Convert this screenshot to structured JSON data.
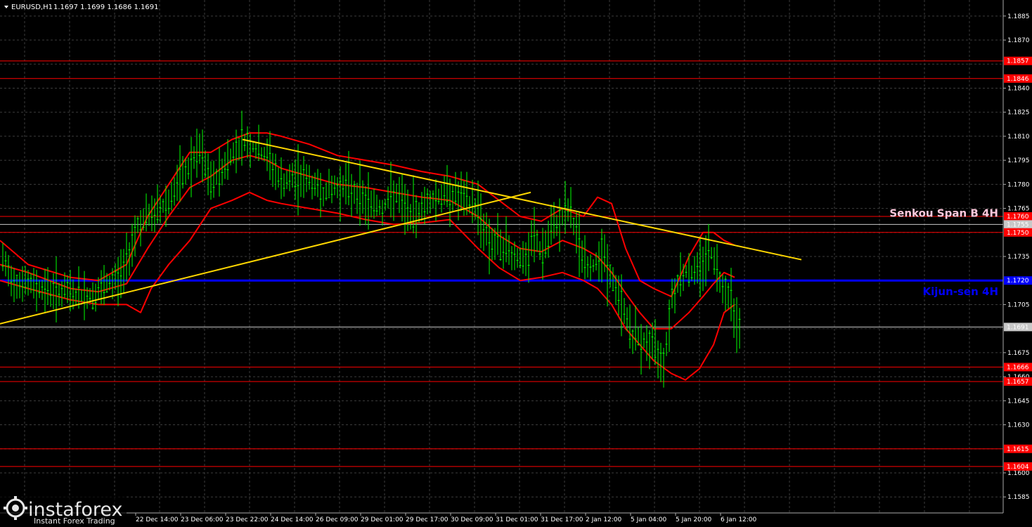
{
  "chart_data": {
    "type": "line",
    "header": {
      "symbol": "EURUSD,H1",
      "ohlc": "1.1697 1.1699 1.1686 1.1691"
    },
    "y_ticks": [
      "1.1885",
      "1.1870",
      "1.1840",
      "1.1825",
      "1.1810",
      "1.1795",
      "1.1780",
      "1.1765",
      "1.1735",
      "1.1705",
      "1.1675",
      "1.1660",
      "1.1645",
      "1.1630",
      "1.1600",
      "1.1585"
    ],
    "x_ticks": [
      "22 Dec 14:00",
      "23 Dec 06:00",
      "23 Dec 22:00",
      "24 Dec 14:00",
      "26 Dec 09:00",
      "29 Dec 01:00",
      "29 Dec 17:00",
      "30 Dec 09:00",
      "31 Dec 01:00",
      "31 Dec 17:00",
      "2 Jan 12:00",
      "5 Jan 04:00",
      "5 Jan 20:00",
      "6 Jan 12:00"
    ],
    "ylim": [
      1.1575,
      1.1895
    ],
    "price_path": [
      [
        0,
        1.174
      ],
      [
        5,
        1.173
      ],
      [
        20,
        1.172
      ],
      [
        60,
        1.1715
      ],
      [
        100,
        1.1712
      ],
      [
        130,
        1.171
      ],
      [
        150,
        1.1715
      ],
      [
        175,
        1.1725
      ],
      [
        195,
        1.1755
      ],
      [
        215,
        1.176
      ],
      [
        240,
        1.177
      ],
      [
        260,
        1.1785
      ],
      [
        285,
        1.18
      ],
      [
        300,
        1.178
      ],
      [
        325,
        1.1795
      ],
      [
        345,
        1.1808
      ],
      [
        370,
        1.18
      ],
      [
        385,
        1.1795
      ],
      [
        400,
        1.178
      ],
      [
        430,
        1.1785
      ],
      [
        460,
        1.1775
      ],
      [
        490,
        1.178
      ],
      [
        520,
        1.177
      ],
      [
        545,
        1.1765
      ],
      [
        560,
        1.1775
      ],
      [
        585,
        1.176
      ],
      [
        610,
        1.177
      ],
      [
        640,
        1.1775
      ],
      [
        660,
        1.177
      ],
      [
        680,
        1.1765
      ],
      [
        695,
        1.1745
      ],
      [
        720,
        1.174
      ],
      [
        750,
        1.173
      ],
      [
        760,
        1.175
      ],
      [
        770,
        1.1735
      ],
      [
        790,
        1.1755
      ],
      [
        810,
        1.1765
      ],
      [
        825,
        1.174
      ],
      [
        840,
        1.1725
      ],
      [
        855,
        1.174
      ],
      [
        870,
        1.172
      ],
      [
        885,
        1.1705
      ],
      [
        900,
        1.1685
      ],
      [
        925,
        1.168
      ],
      [
        945,
        1.167
      ],
      [
        955,
        1.171
      ],
      [
        970,
        1.1725
      ],
      [
        990,
        1.1725
      ],
      [
        1010,
        1.174
      ],
      [
        1025,
        1.172
      ],
      [
        1040,
        1.171
      ],
      [
        1050,
        1.1691
      ]
    ],
    "bands": {
      "upper": [
        [
          0,
          1.1745
        ],
        [
          40,
          1.173
        ],
        [
          100,
          1.1722
        ],
        [
          140,
          1.172
        ],
        [
          180,
          1.173
        ],
        [
          210,
          1.176
        ],
        [
          240,
          1.178
        ],
        [
          270,
          1.18
        ],
        [
          300,
          1.18
        ],
        [
          330,
          1.1808
        ],
        [
          355,
          1.1812
        ],
        [
          380,
          1.1812
        ],
        [
          400,
          1.181
        ],
        [
          440,
          1.1805
        ],
        [
          480,
          1.1798
        ],
        [
          520,
          1.1795
        ],
        [
          560,
          1.1792
        ],
        [
          600,
          1.1788
        ],
        [
          640,
          1.1785
        ],
        [
          680,
          1.178
        ],
        [
          710,
          1.177
        ],
        [
          740,
          1.176
        ],
        [
          770,
          1.1757
        ],
        [
          800,
          1.1765
        ],
        [
          830,
          1.176
        ],
        [
          850,
          1.1772
        ],
        [
          870,
          1.1768
        ],
        [
          890,
          1.174
        ],
        [
          910,
          1.172
        ],
        [
          930,
          1.1715
        ],
        [
          955,
          1.171
        ],
        [
          980,
          1.1735
        ],
        [
          1000,
          1.175
        ],
        [
          1015,
          1.175
        ],
        [
          1030,
          1.1745
        ],
        [
          1045,
          1.1742
        ]
      ],
      "middle": [
        [
          0,
          1.173
        ],
        [
          40,
          1.1725
        ],
        [
          100,
          1.1715
        ],
        [
          140,
          1.1713
        ],
        [
          180,
          1.1718
        ],
        [
          210,
          1.174
        ],
        [
          240,
          1.176
        ],
        [
          270,
          1.1778
        ],
        [
          300,
          1.1785
        ],
        [
          330,
          1.1795
        ],
        [
          355,
          1.1798
        ],
        [
          380,
          1.1795
        ],
        [
          400,
          1.179
        ],
        [
          440,
          1.1785
        ],
        [
          480,
          1.178
        ],
        [
          520,
          1.1778
        ],
        [
          560,
          1.1775
        ],
        [
          600,
          1.1772
        ],
        [
          640,
          1.177
        ],
        [
          680,
          1.176
        ],
        [
          710,
          1.1748
        ],
        [
          740,
          1.174
        ],
        [
          770,
          1.1738
        ],
        [
          800,
          1.1745
        ],
        [
          830,
          1.174
        ],
        [
          850,
          1.1735
        ],
        [
          870,
          1.1725
        ],
        [
          890,
          1.1712
        ],
        [
          910,
          1.17
        ],
        [
          930,
          1.169
        ],
        [
          955,
          1.169
        ],
        [
          980,
          1.17
        ],
        [
          1000,
          1.171
        ],
        [
          1015,
          1.1718
        ],
        [
          1030,
          1.1725
        ],
        [
          1045,
          1.1722
        ]
      ],
      "lower": [
        [
          0,
          1.172
        ],
        [
          40,
          1.1715
        ],
        [
          100,
          1.1708
        ],
        [
          140,
          1.1705
        ],
        [
          180,
          1.1705
        ],
        [
          200,
          1.17
        ],
        [
          215,
          1.1715
        ],
        [
          240,
          1.173
        ],
        [
          270,
          1.1745
        ],
        [
          300,
          1.1765
        ],
        [
          330,
          1.177
        ],
        [
          355,
          1.1775
        ],
        [
          380,
          1.177
        ],
        [
          400,
          1.1768
        ],
        [
          440,
          1.1765
        ],
        [
          480,
          1.1762
        ],
        [
          520,
          1.1758
        ],
        [
          560,
          1.1755
        ],
        [
          600,
          1.1756
        ],
        [
          640,
          1.1758
        ],
        [
          680,
          1.174
        ],
        [
          710,
          1.1728
        ],
        [
          740,
          1.172
        ],
        [
          770,
          1.1722
        ],
        [
          800,
          1.1725
        ],
        [
          830,
          1.172
        ],
        [
          850,
          1.1715
        ],
        [
          870,
          1.1705
        ],
        [
          890,
          1.169
        ],
        [
          910,
          1.168
        ],
        [
          930,
          1.167
        ],
        [
          955,
          1.1662
        ],
        [
          975,
          1.1658
        ],
        [
          995,
          1.1665
        ],
        [
          1015,
          1.168
        ],
        [
          1030,
          1.17
        ],
        [
          1045,
          1.1705
        ]
      ]
    },
    "trendlines": [
      {
        "from": [
          0,
          1.1693
        ],
        "to": [
          755,
          1.1775
        ]
      },
      {
        "from": [
          345,
          1.1808
        ],
        "to": [
          1140,
          1.1733
        ]
      }
    ],
    "levels": [
      {
        "value": 1.1857,
        "label": "1.1857",
        "color": "#ff0000"
      },
      {
        "value": 1.1846,
        "label": "1.1846",
        "color": "#ff0000"
      },
      {
        "value": 1.176,
        "label": "1.1760",
        "color": "#ff0000"
      },
      {
        "value": 1.1755,
        "label": "1.1755",
        "color": "#c8c8c8"
      },
      {
        "value": 1.175,
        "label": "1.1750",
        "color": "#ff0000"
      },
      {
        "value": 1.172,
        "label": "1.1720",
        "color": "#0000ff"
      },
      {
        "value": 1.1691,
        "label": "1.1691",
        "color": "#c8c8c8"
      },
      {
        "value": 1.1666,
        "label": "1.1666",
        "color": "#ff0000"
      },
      {
        "value": 1.1657,
        "label": "1.1657",
        "color": "#ff0000"
      },
      {
        "value": 1.1615,
        "label": "1.1615",
        "color": "#ff0000"
      },
      {
        "value": 1.1604,
        "label": "1.1604",
        "color": "#ff0000"
      }
    ],
    "annotations": [
      {
        "text": "Senkou Span B 4H",
        "value": 1.1762,
        "color": "#ffc8dc"
      },
      {
        "text": "Kijun-sen 4H",
        "value": 1.1713,
        "color": "#0000ff"
      }
    ],
    "colors": {
      "background": "#000000",
      "grid": "#3c3c3c",
      "price": "#00ff00",
      "bands": "#ff0000",
      "trend": "#ffd700",
      "kijun": "#0000ff"
    }
  },
  "watermark": {
    "brand": "instaforex",
    "tagline": "Instant Forex Trading",
    "icon": "gear-icon"
  }
}
